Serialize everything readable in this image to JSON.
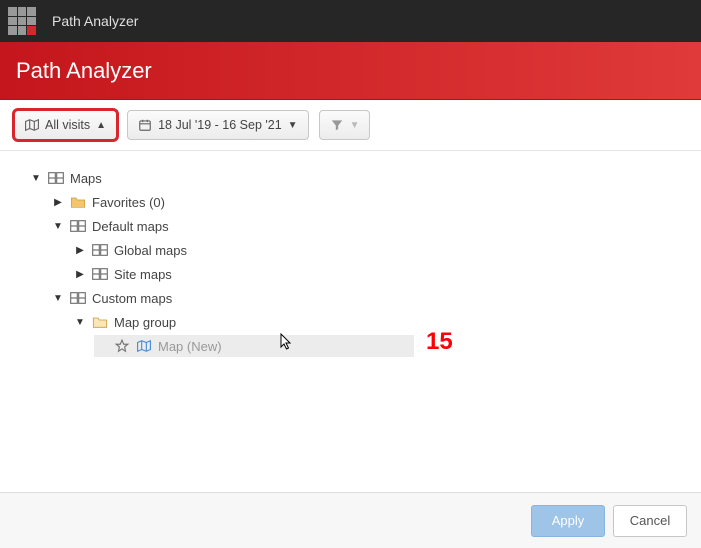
{
  "topbar": {
    "title": "Path Analyzer"
  },
  "banner": {
    "title": "Path Analyzer"
  },
  "toolbar": {
    "visits_label": "All visits",
    "date_range": "18 Jul '19 - 16 Sep '21"
  },
  "tree": {
    "root": "Maps",
    "favorites": "Favorites (0)",
    "default_maps": "Default maps",
    "global_maps": "Global maps",
    "site_maps": "Site maps",
    "custom_maps": "Custom maps",
    "map_group": "Map group",
    "new_map": "Map (New)"
  },
  "footer": {
    "apply": "Apply",
    "cancel": "Cancel"
  },
  "annotation": {
    "step": "15"
  }
}
